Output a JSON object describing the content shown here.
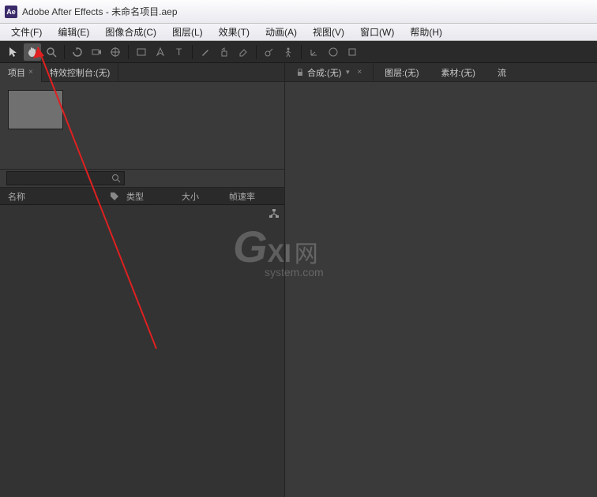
{
  "titlebar": {
    "icon_text": "Ae",
    "text": "Adobe After Effects - 未命名项目.aep"
  },
  "menubar": {
    "items": [
      "文件(F)",
      "编辑(E)",
      "图像合成(C)",
      "图层(L)",
      "效果(T)",
      "动画(A)",
      "视图(V)",
      "窗口(W)",
      "帮助(H)"
    ]
  },
  "toolbar": {
    "snap_text": ""
  },
  "left_panel": {
    "tabs": [
      "项目",
      "特效控制台:(无)"
    ],
    "search_placeholder": "",
    "columns": {
      "name": "名称",
      "type": "类型",
      "size": "大小",
      "rate": "帧速率"
    }
  },
  "right_panel": {
    "tabs": [
      "合成:(无)",
      "图层:(无)",
      "素材:(无)",
      "流"
    ]
  },
  "watermark": {
    "g": "G",
    "xi": "XI",
    "cn": "网",
    "sys": "system.com"
  }
}
